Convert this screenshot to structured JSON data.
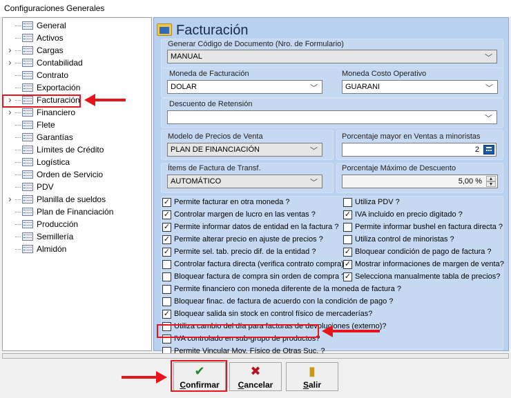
{
  "window": {
    "title": "Configuraciones Generales"
  },
  "tree": [
    {
      "label": "General",
      "expandable": false
    },
    {
      "label": "Activos",
      "expandable": false
    },
    {
      "label": "Cargas",
      "expandable": true
    },
    {
      "label": "Contabilidad",
      "expandable": true
    },
    {
      "label": "Contrato",
      "expandable": false
    },
    {
      "label": "Exportación",
      "expandable": false
    },
    {
      "label": "Facturación",
      "expandable": true,
      "selected": true
    },
    {
      "label": "Financiero",
      "expandable": true
    },
    {
      "label": "Flete",
      "expandable": false
    },
    {
      "label": "Garantías",
      "expandable": false
    },
    {
      "label": "Límites de Crédito",
      "expandable": false
    },
    {
      "label": "Logística",
      "expandable": false
    },
    {
      "label": "Orden de Servicio",
      "expandable": false
    },
    {
      "label": "PDV",
      "expandable": false
    },
    {
      "label": "Planilla de sueldos",
      "expandable": true
    },
    {
      "label": "Plan de Financiación",
      "expandable": false
    },
    {
      "label": "Producción",
      "expandable": false
    },
    {
      "label": "Semillería",
      "expandable": false
    },
    {
      "label": "Almidón",
      "expandable": false
    }
  ],
  "panel": {
    "title": "Facturación",
    "codigo_label": "Generar Código de Documento (Nro. de Formulario)",
    "codigo_value": "MANUAL",
    "moneda_fact_label": "Moneda de Facturación",
    "moneda_fact_value": "DOLAR",
    "moneda_costo_label": "Moneda Costo Operativo",
    "moneda_costo_value": "GUARANI",
    "descuento_ret_label": "Descuento de Retensión",
    "descuento_ret_value": "",
    "modelo_precios_label": "Modelo de Precios de Venta",
    "modelo_precios_value": "PLAN DE FINANCIACIÓN",
    "porcentaje_mayor_label": "Porcentaje mayor en Ventas a minoristas",
    "porcentaje_mayor_value": "2",
    "items_fact_label": "Ítems de Factura de Transf.",
    "items_fact_value": "AUTOMÁTICO",
    "porcentaje_max_label": "Porcentaje Máximo de Descuento",
    "porcentaje_max_value": "5,00 %"
  },
  "checks_left": [
    {
      "label": "Permite facturar en otra moneda ?",
      "checked": true
    },
    {
      "label": "Controlar margen de lucro en las ventas ?",
      "checked": true
    },
    {
      "label": "Permite  informar datos de entidad en la factura ?",
      "checked": true
    },
    {
      "label": "Permite alterar precio en ajuste de precios ?",
      "checked": true
    },
    {
      "label": "Permite sel. tab. precio dif. de la entidad ?",
      "checked": true
    },
    {
      "label": "Controlar factura directa (verifica contrato compra)",
      "checked": false
    },
    {
      "label": "Bloquear factura de compra sin orden de compra ?",
      "checked": false
    }
  ],
  "checks_right": [
    {
      "label": "Utiliza PDV ?",
      "checked": false
    },
    {
      "label": "IVA incluido en precio digitado ?",
      "checked": true
    },
    {
      "label": "Permite informar bushel en factura directa ?",
      "checked": false
    },
    {
      "label": "Utiliza control de minoristas ?",
      "checked": false
    },
    {
      "label": "Bloquear condición de pago de factura ?",
      "checked": true
    },
    {
      "label": "Mostrar informaciones de margen de venta?",
      "checked": true
    },
    {
      "label": "Selecciona manualmente tabla de precios?",
      "checked": true
    }
  ],
  "checks_full": [
    {
      "label": "Permite financiero con moneda diferente de la moneda de factura ?",
      "checked": false
    },
    {
      "label": "Bloquear finac. de factura de acuerdo con la condición de pago ?",
      "checked": false
    },
    {
      "label": "Bloquear salida sin stock en control físico de mercaderías?",
      "checked": true
    },
    {
      "label": "Utiliza cambio del día para facturas de devoluciones (externo)?",
      "checked": false
    },
    {
      "label": "IVA controlado en sub-grupo de productos?",
      "checked": false
    },
    {
      "label": "Permite Vincular Mov. Físico de Otras Suc. ?",
      "checked": false
    }
  ],
  "buttons": {
    "confirmar": {
      "u": "C",
      "rest": "onfirmar",
      "icon": "✔",
      "color": "#1c8a2a"
    },
    "cancelar": {
      "u": "C",
      "rest": "ancelar",
      "icon": "✖",
      "color": "#b5121b"
    },
    "salir": {
      "u": "S",
      "rest": "alir",
      "icon": "▮",
      "color": "#c89a18"
    }
  },
  "colors": {
    "panel_bg": "#b9d1f0",
    "highlight": "#e8141c"
  }
}
